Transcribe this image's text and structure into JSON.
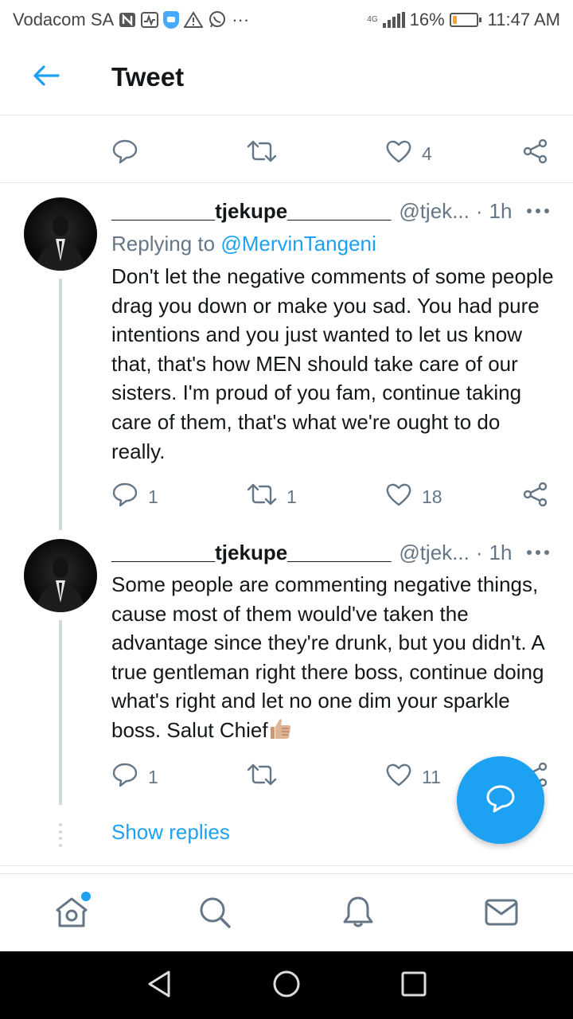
{
  "status_bar": {
    "carrier": "Vodacom SA",
    "network": "4G",
    "battery_percent_label": "16%",
    "battery_level": 0.16,
    "time": "11:47 AM",
    "overflow": "···"
  },
  "header": {
    "title": "Tweet"
  },
  "previous_tweet_actions": {
    "reply_count": "",
    "retweet_count": "",
    "like_count": "4"
  },
  "tweets": [
    {
      "display_name": "_________tjekupe_________",
      "handle": "@tjek...",
      "separator": "·",
      "time": "1h",
      "replying_prefix": "Replying to ",
      "replying_to": "@MervinTangeni",
      "text": "Don't let the negative comments of some people drag you down or make you sad. You had pure intentions and you just wanted to let us know that, that's how MEN should take care of our sisters. I'm proud of you fam, continue taking care of them, that's what we're ought to do really.",
      "reply_count": "1",
      "retweet_count": "1",
      "like_count": "18"
    },
    {
      "display_name": "_________tjekupe_________",
      "handle": "@tjek...",
      "separator": "·",
      "time": "1h",
      "text": "Some people are commenting negative things, cause most of them would've taken the advantage since they're drunk, but you didn't. A true gentleman right there boss, continue doing what's right and let no one dim your sparkle boss. Salut Chief",
      "reply_count": "1",
      "retweet_count": "",
      "like_count": "11"
    }
  ],
  "show_replies_label": "Show replies",
  "icons": {
    "back": "arrow-left-icon",
    "reply": "speech-bubble-icon",
    "retweet": "retweet-icon",
    "like": "heart-icon",
    "share": "share-icon",
    "more": "more-horizontal-icon",
    "compose": "compose-reply-icon",
    "home": "home-icon",
    "search": "search-icon",
    "notifications": "bell-icon",
    "messages": "envelope-icon",
    "emoji": "thumbs-up-emoji"
  },
  "colors": {
    "accent": "#1da1f2",
    "text": "#14171a",
    "secondary": "#657786",
    "border": "#e1e8ed",
    "thread_line": "#cfd9de",
    "system_nav": "#000000"
  }
}
